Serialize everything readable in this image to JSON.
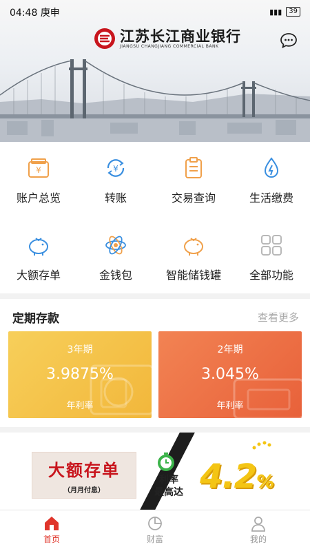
{
  "status_bar": {
    "time": "04:48",
    "day": "庚申",
    "battery": "39"
  },
  "header": {
    "bank_name_cn": "江苏长江商业银行",
    "bank_name_en": "JIANGSU CHANGJIANG COMMERCIAL BANK",
    "message_icon": "chat-icon"
  },
  "menu": {
    "items": [
      {
        "label": "账户总览",
        "icon": "wallet-icon"
      },
      {
        "label": "转账",
        "icon": "transfer-icon"
      },
      {
        "label": "交易查询",
        "icon": "clipboard-icon"
      },
      {
        "label": "生活缴费",
        "icon": "water-drop-icon"
      },
      {
        "label": "大额存单",
        "icon": "piggy-bank-icon"
      },
      {
        "label": "金钱包",
        "icon": "atom-icon"
      },
      {
        "label": "智能储钱罐",
        "icon": "piggy-bank-icon"
      },
      {
        "label": "全部功能",
        "icon": "grid-icon"
      }
    ]
  },
  "deposit": {
    "title": "定期存款",
    "more": "查看更多",
    "cards": [
      {
        "term": "3年期",
        "rate": "3.9875%",
        "label": "年利率",
        "color": "#f3bf48"
      },
      {
        "term": "2年期",
        "rate": "3.045%",
        "label": "年利率",
        "color": "#ec7045"
      }
    ]
  },
  "banner": {
    "main": "大额存单",
    "sub": "（月月付息）",
    "rate_line1": "利率",
    "rate_line2": "最高达",
    "value": "4.2",
    "unit": "%"
  },
  "tabbar": {
    "tabs": [
      {
        "label": "首页",
        "icon": "home-icon",
        "active": true
      },
      {
        "label": "财富",
        "icon": "pie-chart-icon",
        "active": false
      },
      {
        "label": "我的",
        "icon": "user-icon",
        "active": false
      }
    ]
  },
  "colors": {
    "accent": "#e0352b",
    "card_yellow": "#f3bf48",
    "card_orange": "#ec7045",
    "banner_gold": "#f4c514"
  }
}
